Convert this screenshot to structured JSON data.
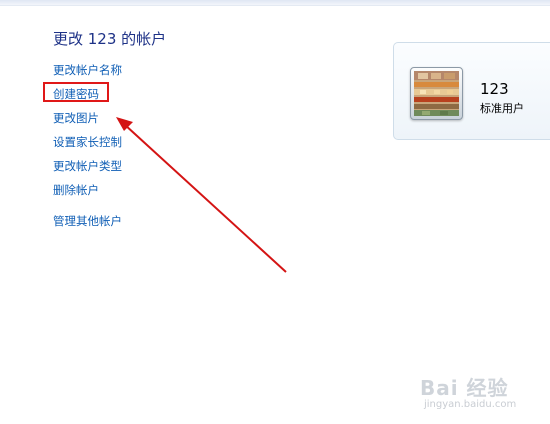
{
  "header": {
    "title": "更改 123 的帐户"
  },
  "tasks": [
    {
      "label": "更改帐户名称"
    },
    {
      "label": "创建密码"
    },
    {
      "label": "更改图片"
    },
    {
      "label": "设置家长控制"
    },
    {
      "label": "更改帐户类型"
    },
    {
      "label": "删除帐户"
    },
    {
      "label": "管理其他帐户"
    }
  ],
  "account": {
    "name": "123",
    "type": "标准用户",
    "avatar_icon": "account-picture-icon"
  },
  "annotation": {
    "highlighted_item": "创建密码",
    "box_color": "#e01818",
    "arrow_color": "#d41414"
  },
  "watermark": {
    "main": "Bai 经验",
    "sub": "jingyan.baidu.com"
  },
  "colors": {
    "link": "#0f5eb5",
    "title": "#1e3287"
  }
}
